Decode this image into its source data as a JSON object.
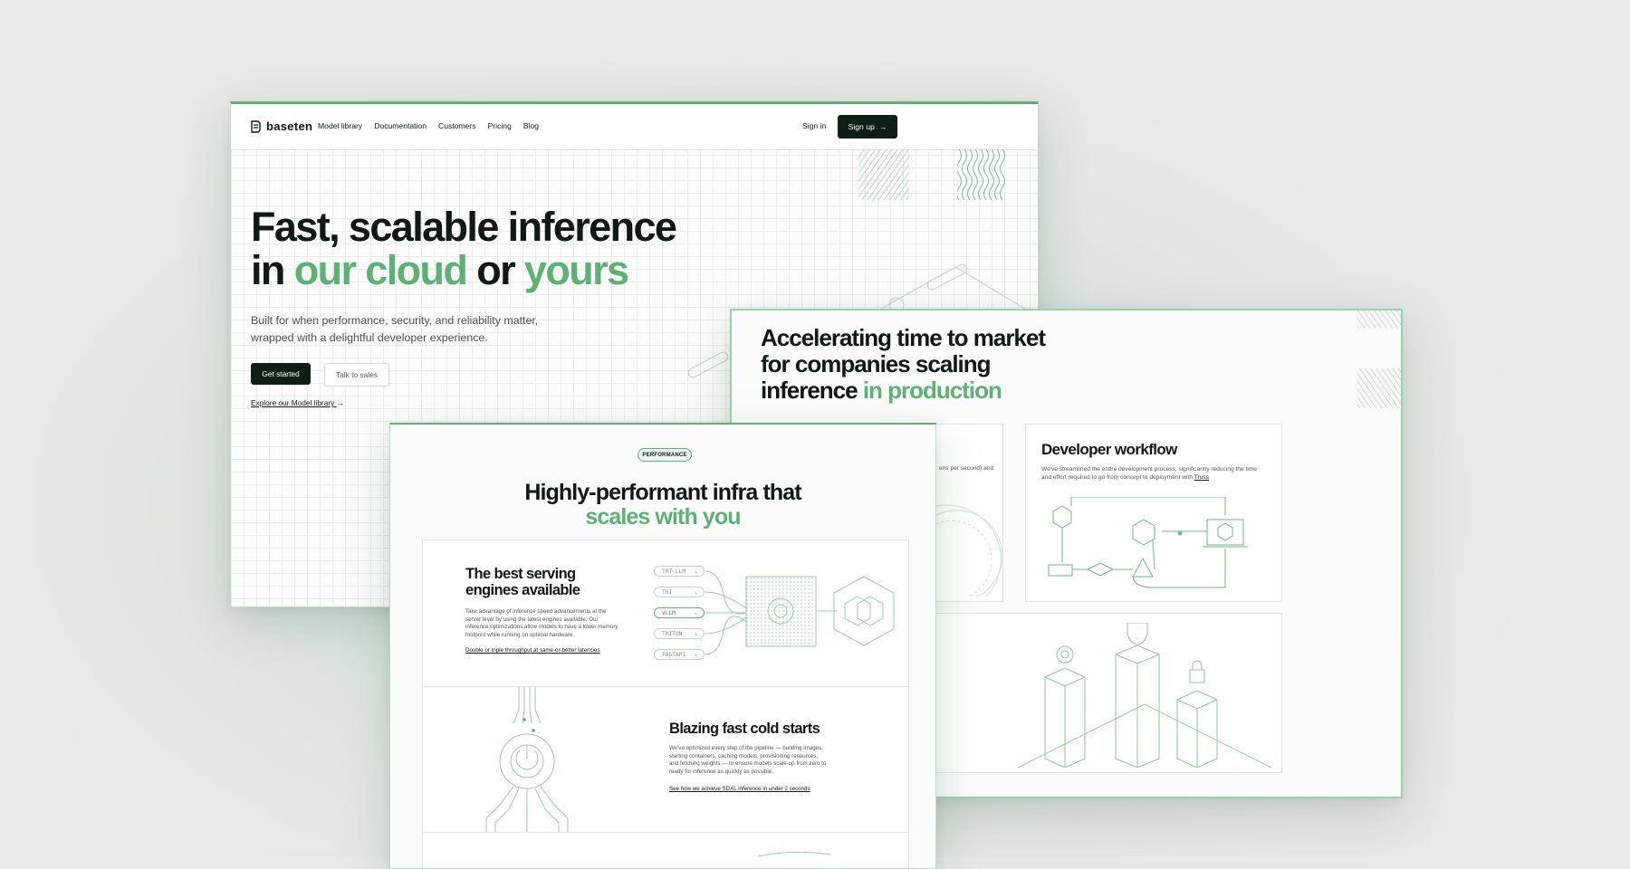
{
  "colors": {
    "accent": "#5fb075",
    "dark": "#0d1f14"
  },
  "window_a": {
    "logo_text": "baseten",
    "nav": [
      "Model library",
      "Documentation",
      "Customers",
      "Pricing",
      "Blog"
    ],
    "sign_in": "Sign in",
    "sign_up": "Sign up",
    "hero": {
      "line1": "Fast, scalable inference",
      "line2_a": "in ",
      "line2_b": "our cloud",
      "line2_c": " or ",
      "line2_d": "yours"
    },
    "subtitle": "Built for when performance, security, and reliability matter, wrapped with a delightful developer experience.",
    "get_started": "Get started",
    "talk_to_sales": "Talk to sales",
    "explore_link": "Explore our Model library"
  },
  "window_b": {
    "hero": {
      "line1": "Accelerating time to market",
      "line2": "for companies scaling",
      "line3_a": "inference ",
      "line3_b": "in production"
    },
    "partial_text": "ens per second) and",
    "dev_workflow": {
      "title": "Developer workflow",
      "desc": "We've streamlined the entire development process, significantly reducing the time and effort required to go from concept to deployment with ",
      "desc_link": "Truss"
    }
  },
  "window_c": {
    "badge": "PERFORMANCE",
    "hero": {
      "line1": "Highly-performant infra that",
      "line2": "scales with you"
    },
    "engines_card": {
      "title_line1": "The best serving",
      "title_line2": "engines available",
      "desc": "Take advantage of inference speed advancements at the server level by using the latest engines available. Our inference optimizations allow models to have a lower memory footprint while running on optimal hardware.",
      "link": "Double or triple throughput at same-or-better latencies",
      "engines": [
        "TRT-LLM",
        "TGI",
        "VLLM",
        "TRITON",
        "FASTAPI"
      ],
      "selected_engine": "VLLM"
    },
    "cold_starts_card": {
      "title": "Blazing fast cold starts",
      "desc": "We've optimized every step of the pipeline — building images, starting containers, caching models, provisioning resources, and fetching weights — to ensure models scale-up from zero to ready for inference as quickly as possible.",
      "link": "See how we achieve SDXL inference in under 2 seconds"
    }
  }
}
